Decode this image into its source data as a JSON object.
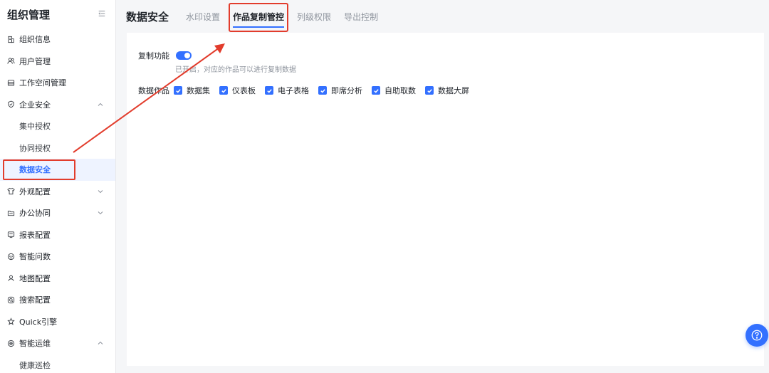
{
  "sidebar": {
    "title": "组织管理",
    "items": [
      {
        "label": "组织信息",
        "icon": "building-icon",
        "expand": ""
      },
      {
        "label": "用户管理",
        "icon": "users-icon",
        "expand": ""
      },
      {
        "label": "工作空间管理",
        "icon": "workspace-icon",
        "expand": ""
      },
      {
        "label": "企业安全",
        "icon": "shield-icon",
        "expand": "up"
      },
      {
        "label": "集中授权",
        "sub": true
      },
      {
        "label": "协同授权",
        "sub": true
      },
      {
        "label": "数据安全",
        "sub": true,
        "active": true
      },
      {
        "label": "外观配置",
        "icon": "shirt-icon",
        "expand": "down"
      },
      {
        "label": "办公协同",
        "icon": "folder-icon",
        "expand": "down"
      },
      {
        "label": "报表配置",
        "icon": "report-icon",
        "expand": ""
      },
      {
        "label": "智能问数",
        "icon": "smart-qa-icon",
        "expand": ""
      },
      {
        "label": "地图配置",
        "icon": "map-pin-icon",
        "expand": ""
      },
      {
        "label": "搜索配置",
        "icon": "search-icon",
        "expand": ""
      },
      {
        "label": "Quick引擎",
        "icon": "engine-icon",
        "expand": ""
      },
      {
        "label": "智能运维",
        "icon": "ops-icon",
        "expand": "up"
      },
      {
        "label": "健康巡检",
        "sub": true
      }
    ]
  },
  "header": {
    "title": "数据安全",
    "tabs": [
      {
        "label": "水印设置",
        "active": false
      },
      {
        "label": "作品复制管控",
        "active": true
      },
      {
        "label": "列级权限",
        "active": false
      },
      {
        "label": "导出控制",
        "active": false
      }
    ]
  },
  "settings": {
    "copy_label": "复制功能",
    "copy_enabled": true,
    "copy_desc": "已开启，对应的作品可以进行复制数据",
    "works_label": "数据作品",
    "works": [
      {
        "label": "数据集",
        "checked": true
      },
      {
        "label": "仪表板",
        "checked": true
      },
      {
        "label": "电子表格",
        "checked": true
      },
      {
        "label": "即席分析",
        "checked": true
      },
      {
        "label": "自助取数",
        "checked": true
      },
      {
        "label": "数据大屏",
        "checked": true
      }
    ]
  },
  "colors": {
    "primary": "#3370ff",
    "annotation": "#e23c2c"
  }
}
